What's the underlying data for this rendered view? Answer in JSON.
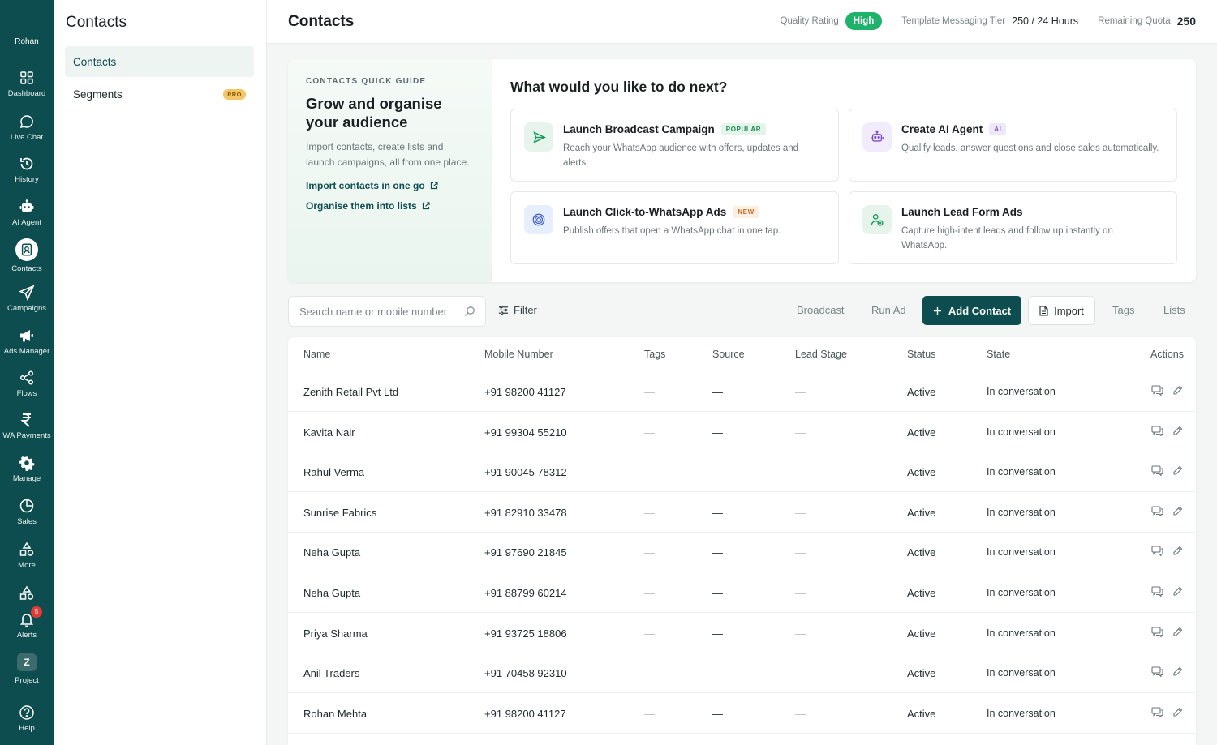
{
  "user": {
    "name": "Rohan"
  },
  "rail": [
    {
      "label": "Dashboard",
      "icon": "dashboard-icon"
    },
    {
      "label": "Live Chat",
      "icon": "chat-icon"
    },
    {
      "label": "History",
      "icon": "history-icon"
    },
    {
      "label": "AI Agent",
      "icon": "robot-icon"
    },
    {
      "label": "Contacts",
      "icon": "contacts-icon"
    },
    {
      "label": "Campaigns",
      "icon": "send-icon"
    },
    {
      "label": "Ads Manager",
      "icon": "megaphone-icon"
    },
    {
      "label": "Flows",
      "icon": "share-icon"
    },
    {
      "label": "WA Payments",
      "icon": "rupee-icon"
    },
    {
      "label": "Manage",
      "icon": "gear-icon"
    },
    {
      "label": "Sales",
      "icon": "pie-icon"
    },
    {
      "label": "More",
      "icon": "shapes-icon"
    },
    {
      "label": "Alerts",
      "icon": "bell-icon",
      "badge": "5"
    },
    {
      "label": "Project",
      "icon": "project-icon",
      "letter": "Z"
    },
    {
      "label": "Help",
      "icon": "help-icon"
    }
  ],
  "sidebar": {
    "title": "Contacts",
    "items": [
      {
        "label": "Contacts",
        "active": true
      },
      {
        "label": "Segments",
        "badge": "PRO"
      }
    ]
  },
  "header": {
    "title": "Contacts",
    "quality_label": "Quality Rating",
    "quality_value": "High",
    "tier_label": "Template Messaging Tier",
    "tier_value": "250 / 24 Hours",
    "quota_label": "Remaining Quota",
    "quota_value": "250"
  },
  "guide": {
    "kicker": "CONTACTS QUICK GUIDE",
    "title": "Grow and organise your audience",
    "description": "Import contacts, create lists and launch campaigns, all from one place.",
    "link1": "Import contacts in one go",
    "link2": "Organise them into lists",
    "next_title": "What would you like to do next?",
    "options": [
      {
        "title": "Launch Broadcast Campaign",
        "tag": "POPULAR",
        "desc": "Reach your WhatsApp audience with offers, updates and alerts.",
        "icon": "send-icon"
      },
      {
        "title": "Create AI Agent",
        "tag": "AI",
        "desc": "Qualify leads, answer questions and close sales automatically.",
        "icon": "robot-icon"
      },
      {
        "title": "Launch Click-to-WhatsApp Ads",
        "tag": "NEW",
        "desc": "Publish offers that open a WhatsApp chat in one tap.",
        "icon": "target-icon"
      },
      {
        "title": "Launch Lead Form Ads",
        "tag": "",
        "desc": "Capture high-intent leads and follow up instantly on WhatsApp.",
        "icon": "user-add-icon"
      }
    ]
  },
  "toolbar": {
    "search_placeholder": "Search name or mobile number",
    "filter": "Filter",
    "broadcast": "Broadcast",
    "run_ad": "Run Ad",
    "add_contact": "Add Contact",
    "import": "Import",
    "tags": "Tags",
    "lists": "Lists"
  },
  "table": {
    "columns": [
      "Name",
      "Mobile Number",
      "Tags",
      "Source",
      "Lead Stage",
      "Status",
      "State",
      "Actions"
    ],
    "rows": [
      {
        "name": "Zenith Retail Pvt Ltd",
        "mobile": "+91 98200 41127",
        "tags": "—",
        "source": "—",
        "lead_stage": "—",
        "status": "Active",
        "state": "In conversation"
      },
      {
        "name": "Kavita Nair",
        "mobile": "+91 99304 55210",
        "tags": "—",
        "source": "—",
        "lead_stage": "—",
        "status": "Active",
        "state": "In conversation"
      },
      {
        "name": "Rahul Verma",
        "mobile": "+91 90045 78312",
        "tags": "—",
        "source": "—",
        "lead_stage": "—",
        "status": "Active",
        "state": "In conversation"
      },
      {
        "name": "Sunrise Fabrics",
        "mobile": "+91 82910 33478",
        "tags": "—",
        "source": "—",
        "lead_stage": "—",
        "status": "Active",
        "state": "In conversation"
      },
      {
        "name": "Neha Gupta",
        "mobile": "+91 97690 21845",
        "tags": "—",
        "source": "—",
        "lead_stage": "—",
        "status": "Active",
        "state": "In conversation"
      },
      {
        "name": "Neha Gupta",
        "mobile": "+91 88799 60214",
        "tags": "—",
        "source": "—",
        "lead_stage": "—",
        "status": "Active",
        "state": "In conversation"
      },
      {
        "name": "Priya Sharma",
        "mobile": "+91 93725 18806",
        "tags": "—",
        "source": "—",
        "lead_stage": "—",
        "status": "Active",
        "state": "In conversation"
      },
      {
        "name": "Anil Traders",
        "mobile": "+91 70458 92310",
        "tags": "—",
        "source": "—",
        "lead_stage": "—",
        "status": "Active",
        "state": "In conversation"
      },
      {
        "name": "Rohan Mehta",
        "mobile": "+91 98200 41127",
        "tags": "—",
        "source": "—",
        "lead_stage": "—",
        "status": "Active",
        "state": "In conversation"
      }
    ]
  },
  "colors": {
    "brand": "#0e4d4f",
    "quality_high": "#1fb26b",
    "alert_badge": "#e53935"
  }
}
